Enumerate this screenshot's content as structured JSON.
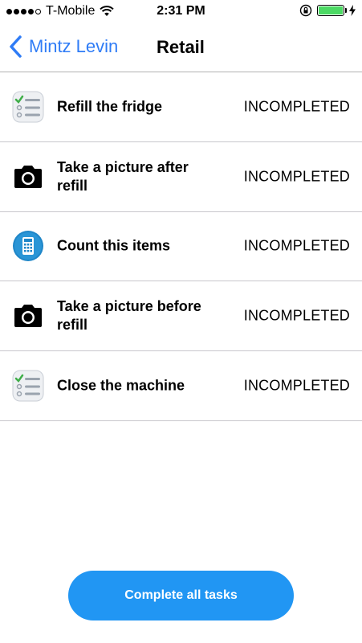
{
  "status_bar": {
    "signal_bars": [
      1,
      1,
      1,
      1,
      0
    ],
    "carrier": "T-Mobile",
    "time": "2:31 PM",
    "battery_color": "#4cd964",
    "battery_level": 1.0
  },
  "nav": {
    "back_label": "Mintz Levin",
    "title": "Retail",
    "accent_color": "#2f7cf6"
  },
  "tasks": [
    {
      "title": "Refill the fridge",
      "status": "INCOMPLETED",
      "icon": "checklist-icon"
    },
    {
      "title": "Take a picture after refill",
      "status": "INCOMPLETED",
      "icon": "camera-icon"
    },
    {
      "title": "Count this items",
      "status": "INCOMPLETED",
      "icon": "calculator-icon"
    },
    {
      "title": "Take a picture before refill",
      "status": "INCOMPLETED",
      "icon": "camera-icon"
    },
    {
      "title": "Close the machine",
      "status": "INCOMPLETED",
      "icon": "checklist-icon"
    }
  ],
  "actions": {
    "complete_all_label": "Complete all tasks",
    "button_color": "#2196f3"
  }
}
